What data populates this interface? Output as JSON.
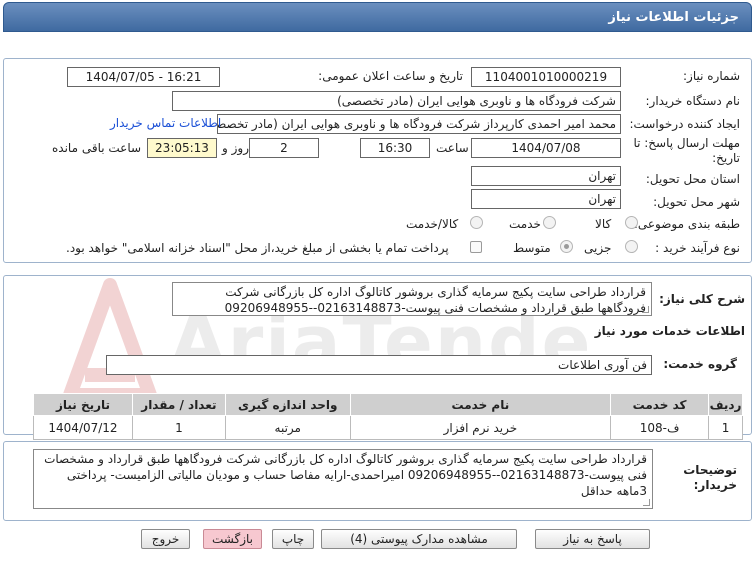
{
  "header": {
    "title": "جزئیات اطلاعات نیاز"
  },
  "form": {
    "need_number_label": "شماره نیاز:",
    "need_number": "1104001010000219",
    "announce_label": "تاریخ و ساعت اعلان عمومی:",
    "announce_value": "1404/07/05 - 16:21",
    "buyer_org_label": "نام دستگاه خریدار:",
    "buyer_org": "شرکت فرودگاه ها و ناوبری هوایی ایران (مادر تخصصی)",
    "creator_label": "ایجاد کننده درخواست:",
    "creator": "محمد امیر احمدی کارپرداز شرکت فرودگاه ها و ناوبری هوایی ایران (مادر تخصصی)",
    "contact_link": "اطلاعات تماس خریدار",
    "deadline_label_1": "مهلت ارسال پاسخ: تا",
    "deadline_label_2": "تاریخ:",
    "deadline_date": "1404/07/08",
    "time_label": "ساعت",
    "deadline_time": "16:30",
    "days": "2",
    "days_label": "روز و",
    "remaining_time": "23:05:13",
    "remaining_label": "ساعت باقی مانده",
    "province_label": "استان محل تحویل:",
    "province": "تهران",
    "city_label": "شهر محل تحویل:",
    "city": "تهران",
    "category_label": "طبقه بندی موضوعی:",
    "category_options": [
      "کالا",
      "خدمت",
      "کالا/خدمت"
    ],
    "process_label": "نوع فرآیند خرید :",
    "process_options": [
      "جزیی",
      "متوسط"
    ],
    "payment_note": "پرداخت تمام یا بخشی از مبلغ خرید،از محل \"اسناد خزانه اسلامی\" خواهد بود."
  },
  "summary": {
    "label": "شرح کلی نیاز:",
    "text": "قرارداد طراحی سایت پکیج سرمایه گذاری بروشور کاتالوگ اداره کل بازرگانی شرکت فرودگاهها طبق قرارداد و مشخصات فنی پیوست-02163148873--09206948955 امیراحمدی"
  },
  "services": {
    "section_title": "اطلاعات خدمات مورد نیاز",
    "group_label": "گروه خدمت:",
    "group_value": "فن آوری اطلاعات",
    "columns": [
      "ردیف",
      "کد خدمت",
      "نام خدمت",
      "واحد اندازه گیری",
      "تعداد / مقدار",
      "تاریخ نیاز"
    ],
    "rows": [
      [
        "1",
        "ف-108",
        "خرید نرم افزار",
        "مرتبه",
        "1",
        "1404/07/12"
      ]
    ]
  },
  "buyer_notes": {
    "label_1": "توضیحات",
    "label_2": "خریدار:",
    "text": "قرارداد طراحی سایت پکیج سرمایه گذاری بروشور کاتالوگ اداره کل بازرگانی شرکت فرودگاهها طبق قرارداد و مشخصات فنی پیوست-02163148873--09206948955 امیراحمدی-ارایه مفاصا حساب و مودیان مالیاتی الزامیست- پرداختی 3ماهه حداقل"
  },
  "buttons": {
    "reply": "پاسخ به نیاز",
    "attachments": "مشاهده مدارک پیوستی (4)",
    "print": "چاپ",
    "back": "بازگشت",
    "exit": "خروج"
  },
  "watermark_text": "AriaTender.net",
  "colors": {
    "header": "#4a73a8",
    "link": "#1a4fd6",
    "table_header": "#cfcfcf",
    "remaining_bg": "#fffacd"
  }
}
